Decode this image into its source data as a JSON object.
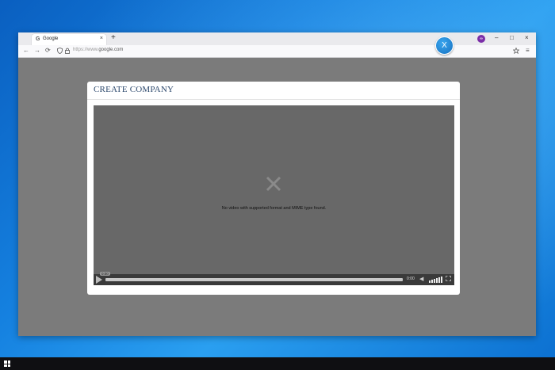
{
  "browser": {
    "tab": {
      "title": "Google",
      "favicon": "G",
      "close_label": "×"
    },
    "new_tab_label": "+",
    "profile_badge": "∞",
    "window_controls": {
      "minimize": "–",
      "maximize": "□",
      "close": "×"
    },
    "nav": {
      "back": "←",
      "forward": "→",
      "reload": "⟳"
    },
    "url": {
      "prefix": "https://www.",
      "domain": "google.com"
    }
  },
  "modal": {
    "title": "CREATE COMPANY",
    "close_label": "X"
  },
  "video": {
    "error_message": "No video with supported format and MIME type found.",
    "current_time": "0:00",
    "end_time": "0:00",
    "volume_level": 0.8
  },
  "colors": {
    "desktop": "#1581e0",
    "overlay": "#7b7b7b",
    "modal_title": "#2e4a6e",
    "close_button": "#1c7cd0"
  }
}
